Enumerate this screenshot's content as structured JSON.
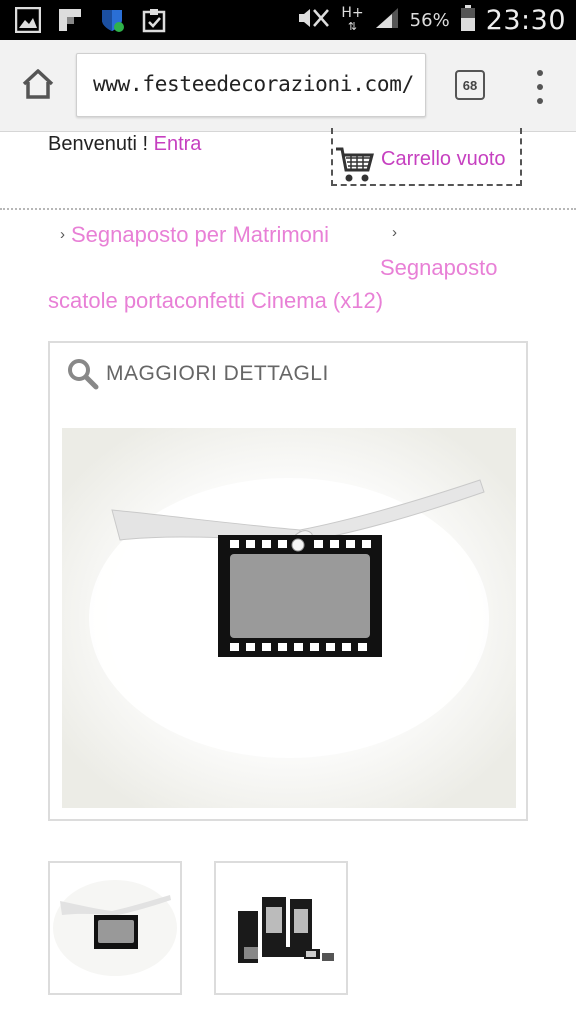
{
  "status_bar": {
    "battery_percent": "56%",
    "time": "23:30",
    "network": "H+"
  },
  "browser": {
    "url": "www.festeedecorazioni.com/",
    "tab_count": "68"
  },
  "header": {
    "welcome_text": "Benvenuti ! ",
    "login_link": "Entra",
    "cart_label": "Carrello vuoto"
  },
  "breadcrumb": {
    "category": "Segnaposto per Matrimoni",
    "subcategory": "Segnaposto",
    "product": "scatole portaconfetti Cinema (x12)"
  },
  "product": {
    "details_label": "MAGGIORI DETTAGLI"
  },
  "colors": {
    "link": "#c640c0",
    "breadcrumb": "#e880d6"
  }
}
